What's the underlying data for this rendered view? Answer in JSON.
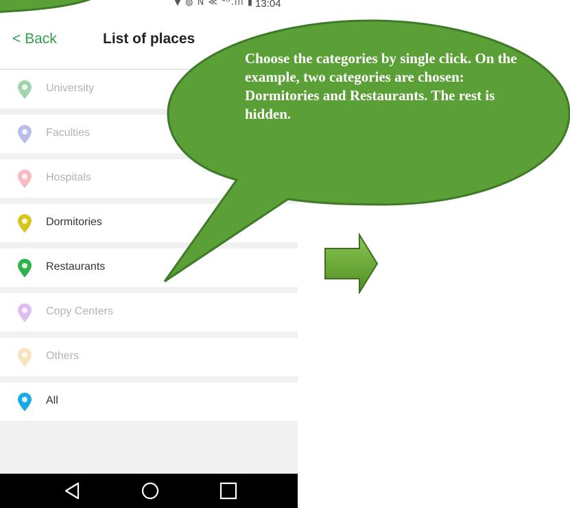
{
  "status_bar": {
    "icons": "▼ ◍ N ≪ ⁴ᴳ.ıll ▮",
    "time": "13:04"
  },
  "header": {
    "back_label": "< Back",
    "title": "List of places"
  },
  "places": [
    {
      "label": "University",
      "state": "hidden",
      "color": "#2e9e4e",
      "icon": "university-pin-icon"
    },
    {
      "label": "Faculties",
      "state": "hidden",
      "color": "#6b6fd6",
      "icon": "faculties-pin-icon"
    },
    {
      "label": "Hospitals",
      "state": "hidden",
      "color": "#f06a78",
      "icon": "hospitals-pin-icon"
    },
    {
      "label": "Dormitories",
      "state": "selected",
      "color": "#d6c51a",
      "icon": "dormitories-pin-icon"
    },
    {
      "label": "Restaurants",
      "state": "selected",
      "color": "#2db34a",
      "icon": "restaurants-pin-icon"
    },
    {
      "label": "Copy Centers",
      "state": "hidden",
      "color": "#b76be0",
      "icon": "copy-centers-pin-icon"
    },
    {
      "label": "Others",
      "state": "hidden",
      "color": "#f5c06a",
      "icon": "others-pin-icon"
    },
    {
      "label": "All",
      "state": "selected",
      "color": "#19a9e6",
      "icon": "all-pin-icon"
    }
  ],
  "navbar": {
    "back_icon": "triangle-back-icon",
    "home_icon": "circle-home-icon",
    "recents_icon": "square-recents-icon"
  },
  "callout": {
    "text": "Choose the categories by single click. On the example, two categories are chosen: Dormitories and Restaurants. The rest is hidden.",
    "fill": "#5b9f37",
    "stroke": "#3f7a28"
  },
  "arrow": {
    "icon": "right-arrow-icon",
    "fill": "#6aaa34"
  }
}
